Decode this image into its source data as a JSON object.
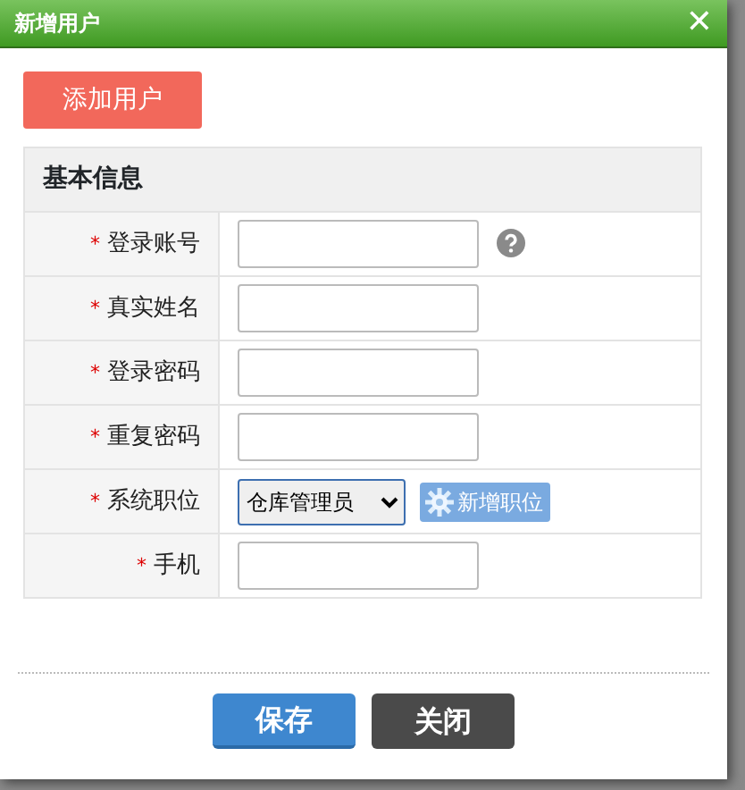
{
  "window": {
    "title": "新增用户",
    "close": "✕"
  },
  "tab_button": "添加用户",
  "section": "基本信息",
  "fields": [
    {
      "kind": "input",
      "required": true,
      "required_mark": "*",
      "label": "登录账号",
      "help": true
    },
    {
      "kind": "input",
      "required": true,
      "required_mark": "*",
      "label": "真实姓名"
    },
    {
      "kind": "input",
      "required": true,
      "required_mark": "*",
      "label": "登录密码"
    },
    {
      "kind": "input",
      "required": true,
      "required_mark": "*",
      "label": "重复密码"
    },
    {
      "kind": "select",
      "required": true,
      "required_mark": "*",
      "label": "系统职位",
      "value": "仓库管理员",
      "action": "新增职位"
    },
    {
      "kind": "input",
      "required": true,
      "required_mark": "*",
      "label": "手机"
    }
  ],
  "buttons": [
    {
      "kind": "primary",
      "label": "保存"
    },
    {
      "kind": "dark",
      "label": "关闭"
    }
  ]
}
